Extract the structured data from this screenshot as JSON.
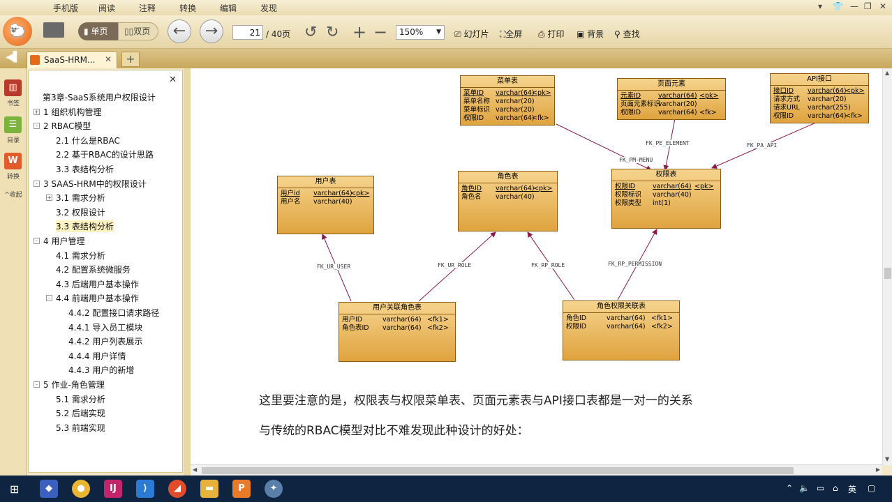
{
  "menubar": {
    "items": [
      "手机版",
      "阅读",
      "注释",
      "转换",
      "编辑",
      "发现"
    ]
  },
  "toolbar": {
    "single_page": "单页",
    "double_page": "双页",
    "page_current": "21",
    "page_total": "/ 40页",
    "zoom": "150%",
    "slideshow": "幻灯片",
    "fullscreen": "全屏",
    "print": "打印",
    "background": "背景",
    "search": "查找"
  },
  "tab": {
    "title": "SaaS-HRM..."
  },
  "rail": {
    "bookmark": "书签",
    "toc": "目录",
    "convert": "转换",
    "collapse": "收起"
  },
  "toc": {
    "items": [
      {
        "label": "第3章-SaaS系统用户权限设计",
        "level": 0
      },
      {
        "label": "1 组织机构管理",
        "level": 1,
        "expander": "+"
      },
      {
        "label": "2 RBAC模型",
        "level": 1,
        "expander": "-"
      },
      {
        "label": "2.1 什么是RBAC",
        "level": 2
      },
      {
        "label": "2.2 基于RBAC的设计思路",
        "level": 2
      },
      {
        "label": "3.3 表结构分析",
        "level": 2
      },
      {
        "label": "3 SAAS-HRM中的权限设计",
        "level": 1,
        "expander": "-"
      },
      {
        "label": "3.1 需求分析",
        "level": 2,
        "expander": "+"
      },
      {
        "label": "3.2 权限设计",
        "level": 2
      },
      {
        "label": "3.3 表结构分析",
        "level": 2,
        "selected": true
      },
      {
        "label": "4 用户管理",
        "level": 1,
        "expander": "-"
      },
      {
        "label": "4.1 需求分析",
        "level": 2
      },
      {
        "label": "4.2 配置系统微服务",
        "level": 2
      },
      {
        "label": "4.3 后端用户基本操作",
        "level": 2
      },
      {
        "label": "4.4 前端用户基本操作",
        "level": 2,
        "expander": "-"
      },
      {
        "label": "4.4.2 配置接口请求路径",
        "level": 3
      },
      {
        "label": "4.4.1 导入员工模块",
        "level": 3
      },
      {
        "label": "4.4.2 用户列表展示",
        "level": 3
      },
      {
        "label": "4.4.4 用户详情",
        "level": 3
      },
      {
        "label": "4.4.3 用户的新增",
        "level": 3
      },
      {
        "label": "5 作业-角色管理",
        "level": 1,
        "expander": "-"
      },
      {
        "label": "5.1 需求分析",
        "level": 2
      },
      {
        "label": "5.2 后端实现",
        "level": 2
      },
      {
        "label": "5.3 前端实现",
        "level": 2
      }
    ]
  },
  "diagram": {
    "tables": {
      "menu": {
        "title": "菜单表",
        "rows": [
          [
            "菜单ID",
            "varchar(64)",
            "<pk>"
          ],
          [
            "菜单名称",
            "varchar(20)",
            ""
          ],
          [
            "菜单标识",
            "varchar(20)",
            ""
          ],
          [
            "权限ID",
            "varchar(64)",
            "<fk>"
          ]
        ]
      },
      "element": {
        "title": "页面元素",
        "rows": [
          [
            "元素ID",
            "varchar(64)",
            "<pk>"
          ],
          [
            "页面元素标识",
            "varchar(20)",
            ""
          ],
          [
            "权限ID",
            "varchar(64)",
            "<fk>"
          ]
        ]
      },
      "api": {
        "title": "API接口",
        "rows": [
          [
            "接口ID",
            "varchar(64)",
            "<pk>"
          ],
          [
            "请求方式",
            "varchar(20)",
            ""
          ],
          [
            "请求URL",
            "varchar(255)",
            ""
          ],
          [
            "权限ID",
            "varchar(64)",
            "<fk>"
          ]
        ]
      },
      "user": {
        "title": "用户表",
        "rows": [
          [
            "用户id",
            "varchar(64)",
            "<pk>"
          ],
          [
            "用户名",
            "varchar(40)",
            ""
          ]
        ]
      },
      "role": {
        "title": "角色表",
        "rows": [
          [
            "角色ID",
            "varchar(64)",
            "<pk>"
          ],
          [
            "角色名",
            "varchar(40)",
            ""
          ]
        ]
      },
      "perm": {
        "title": "权限表",
        "rows": [
          [
            "权限ID",
            "varchar(64)",
            "<pk>"
          ],
          [
            "权限标识",
            "varchar(40)",
            ""
          ],
          [
            "权限类型",
            "int(1)",
            ""
          ]
        ]
      },
      "userrole": {
        "title": "用户关联角色表",
        "rows": [
          [
            "用户ID",
            "varchar(64)",
            "<fk1>"
          ],
          [
            "角色表ID",
            "varchar(64)",
            "<fk2>"
          ]
        ]
      },
      "roleperm": {
        "title": "角色权限关联表",
        "rows": [
          [
            "角色ID",
            "varchar(64)",
            "<fk1>"
          ],
          [
            "权限ID",
            "varchar(64)",
            "<fk2>"
          ]
        ]
      }
    },
    "relations": {
      "pe": "FK_PE_ELEMENT",
      "pm": "FK_PM-MENU",
      "pa": "FK_PA_API",
      "ur_user": "FK_UR_USER",
      "ur_role": "FK_UR_ROLE",
      "rp_role": "FK_RP_ROLE",
      "rp_perm": "FK_RP_PERMISSION"
    }
  },
  "document": {
    "para1": "这里要注意的是，权限表与权限菜单表、页面元素表与API接口表都是一对一的关系",
    "para2": "与传统的RBAC模型对比不难发现此种设计的好处："
  },
  "taskbar": {
    "ime": "英"
  }
}
